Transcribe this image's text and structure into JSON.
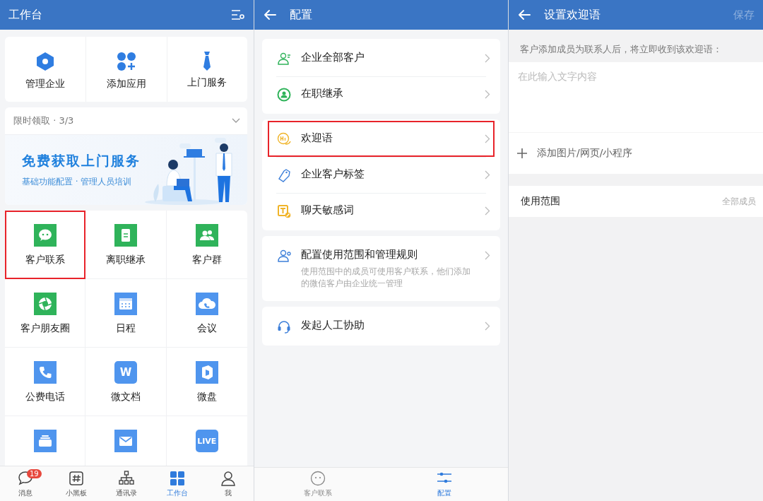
{
  "workbench": {
    "title": "工作台",
    "quick_actions": [
      {
        "label": "管理企业"
      },
      {
        "label": "添加应用"
      },
      {
        "label": "上门服务"
      }
    ],
    "promo": {
      "header": "限时领取 · 3/3",
      "title": "免费获取上门服务",
      "subtitle": "基础功能配置 · 管理人员培训"
    },
    "apps": [
      {
        "label": "客户联系",
        "color": "#2fb35a",
        "highlighted": true
      },
      {
        "label": "离职继承",
        "color": "#2fb35a",
        "highlighted": false
      },
      {
        "label": "客户群",
        "color": "#2fb35a",
        "highlighted": false
      },
      {
        "label": "客户朋友圈",
        "color": "#2fb35a",
        "highlighted": false
      },
      {
        "label": "日程",
        "color": "#4f95ee",
        "highlighted": false
      },
      {
        "label": "会议",
        "color": "#4f95ee",
        "highlighted": false
      },
      {
        "label": "公费电话",
        "color": "#4f95ee",
        "highlighted": false
      },
      {
        "label": "微文档",
        "color": "#4f95ee",
        "highlighted": false,
        "tile_text": "W"
      },
      {
        "label": "微盘",
        "color": "#4f95ee",
        "highlighted": false
      },
      {
        "color": "#4f95ee",
        "highlighted": false
      },
      {
        "color": "#4f95ee",
        "highlighted": false
      },
      {
        "color": "#4f95ee",
        "highlighted": false,
        "tile_text": "LIVE"
      }
    ],
    "tab_bar": [
      {
        "label": "消息",
        "badge": "19",
        "selected": false
      },
      {
        "label": "小黑板",
        "selected": false
      },
      {
        "label": "通讯录",
        "selected": false
      },
      {
        "label": "工作台",
        "selected": true
      },
      {
        "label": "我",
        "selected": false
      }
    ]
  },
  "config": {
    "title": "配置",
    "groups": [
      {
        "items": [
          {
            "label": "企业全部客户",
            "color": "#2fb35a",
            "highlighted": false
          },
          {
            "label": "在职继承",
            "color": "#2fb35a",
            "highlighted": false
          }
        ]
      },
      {
        "items": [
          {
            "label": "欢迎语",
            "color": "#f0b429",
            "highlighted": true
          },
          {
            "label": "企业客户标签",
            "color": "#3d7fd9",
            "highlighted": false
          },
          {
            "label": "聊天敏感词",
            "color": "#f0b429",
            "highlighted": false
          }
        ]
      },
      {
        "items": [
          {
            "label": "配置使用范围和管理规则",
            "description": "使用范围中的成员可使用客户联系，他们添加的微信客户由企业统一管理",
            "color": "#3d7fd9",
            "highlighted": false
          }
        ]
      },
      {
        "items": [
          {
            "label": "发起人工协助",
            "color": "#3d7fd9",
            "highlighted": false
          }
        ]
      }
    ],
    "tab_bar": [
      {
        "label": "客户联系",
        "selected": false
      },
      {
        "label": "配置",
        "selected": true
      }
    ]
  },
  "welcome": {
    "title": "设置欢迎语",
    "save": {
      "label": "保存",
      "disabled": true
    },
    "hint": "客户添加成员为联系人后，将立即收到该欢迎语：",
    "placeholder": "在此输入文字内容",
    "add_attachment": "添加图片/网页/小程序",
    "scope": {
      "label": "使用范围",
      "value": "全部成员"
    }
  }
}
